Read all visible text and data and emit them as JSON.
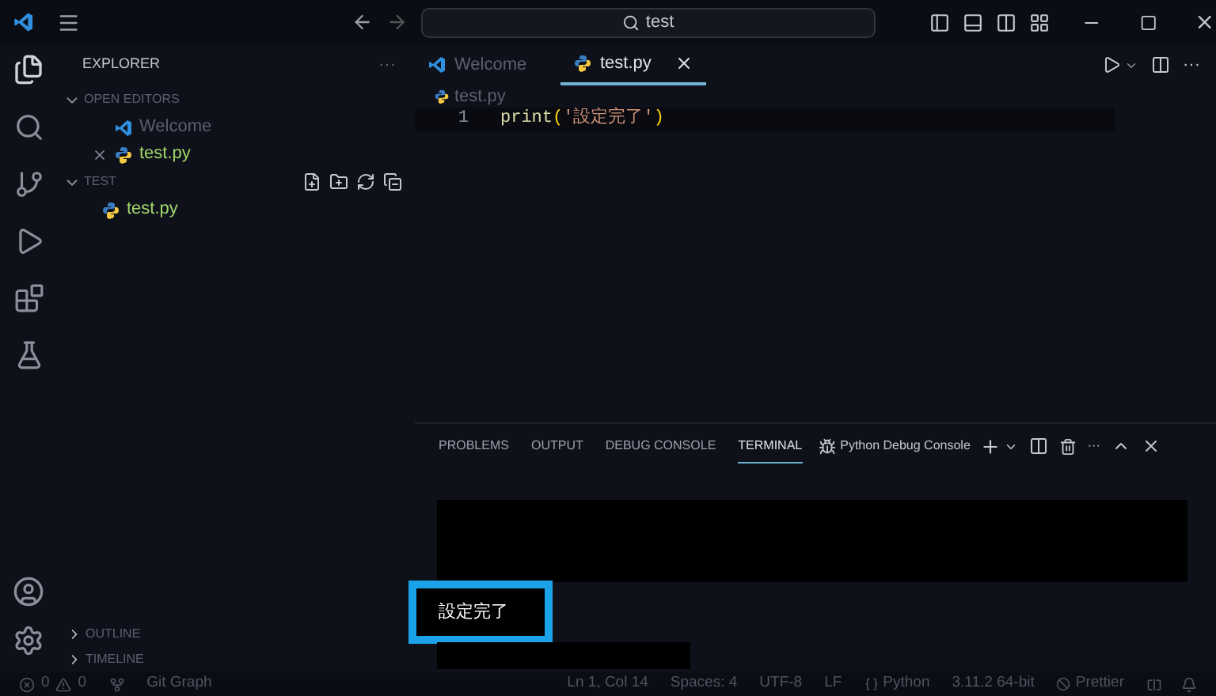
{
  "title_bar": {
    "search": "test"
  },
  "sidebar": {
    "title": "EXPLORER",
    "more": "···",
    "sections": [
      {
        "label": "OPEN EDITORS",
        "expanded": true,
        "items": [
          {
            "name": "Welcome",
            "kind": "vscode",
            "dirty_close": false
          },
          {
            "name": "test.py",
            "kind": "python",
            "dirty_close": true
          }
        ]
      },
      {
        "label": "TEST",
        "expanded": true,
        "toolbar": true,
        "items": [
          {
            "name": "test.py",
            "kind": "python"
          }
        ]
      }
    ],
    "bottom_sections": [
      {
        "label": "OUTLINE",
        "expanded": false
      },
      {
        "label": "TIMELINE",
        "expanded": false
      }
    ]
  },
  "editor": {
    "tabs": [
      {
        "label": "Welcome",
        "kind": "vscode",
        "selected": false
      },
      {
        "label": "test.py",
        "kind": "python",
        "selected": true
      }
    ],
    "breadcrumb": "test.py",
    "lines": [
      {
        "number": "1",
        "tokens": [
          {
            "text": "print",
            "kind": "function"
          },
          {
            "text": "(",
            "kind": "bracket"
          },
          {
            "text": "'設定完了'",
            "kind": "string"
          },
          {
            "text": ")",
            "kind": "bracket"
          }
        ]
      }
    ]
  },
  "panel": {
    "tabs": [
      {
        "label": "PROBLEMS",
        "selected": false
      },
      {
        "label": "OUTPUT",
        "selected": false
      },
      {
        "label": "DEBUG CONSOLE",
        "selected": false
      },
      {
        "label": "TERMINAL",
        "selected": true
      }
    ],
    "terminal_name": "Python Debug Console",
    "more": "···",
    "output": "設定完了"
  },
  "status_bar": {
    "errors": "0",
    "warnings": "0",
    "git": "Git Graph",
    "right": [
      {
        "text": "Ln 1, Col 14",
        "kind": "text"
      },
      {
        "text": "Spaces: 4",
        "kind": "text"
      },
      {
        "text": "UTF-8",
        "kind": "text"
      },
      {
        "text": "LF",
        "kind": "text"
      },
      {
        "text": "Python",
        "kind": "language"
      },
      {
        "text": "3.11.2 64-bit",
        "kind": "text"
      },
      {
        "text": "Prettier",
        "kind": "prettier"
      }
    ]
  }
}
